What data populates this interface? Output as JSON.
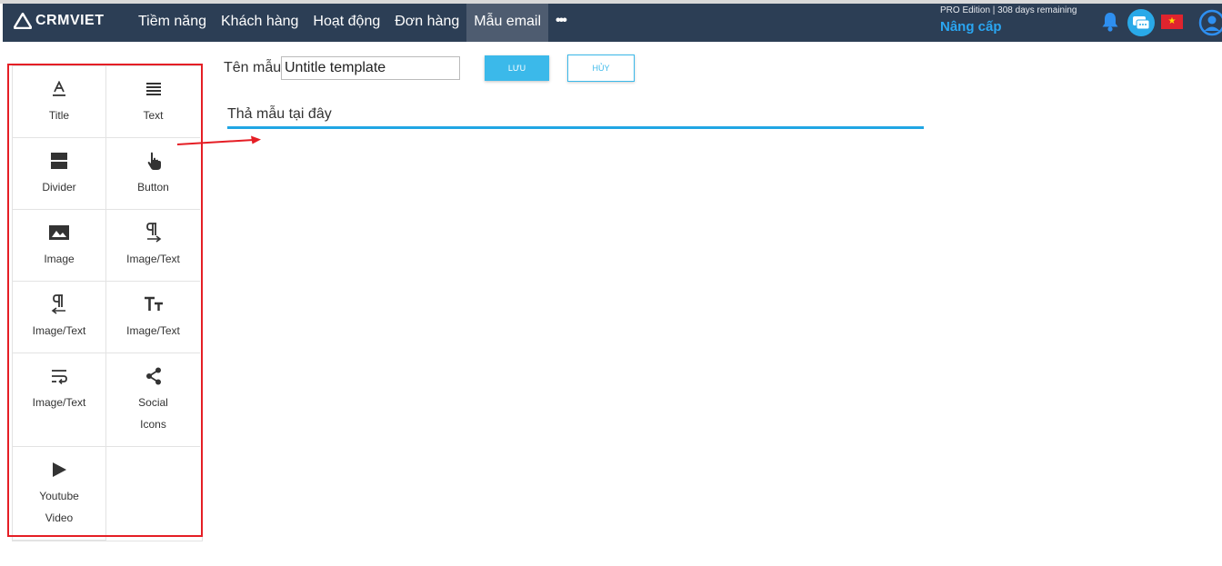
{
  "app": {
    "logo_text": "CRMVIET"
  },
  "nav": {
    "items": [
      {
        "label": "Tiềm năng"
      },
      {
        "label": "Khách hàng"
      },
      {
        "label": "Hoạt động"
      },
      {
        "label": "Đơn hàng"
      },
      {
        "label": "Mẫu email",
        "active": true
      }
    ],
    "more_label": "•••"
  },
  "account": {
    "edition": "PRO Edition | 308 days remaining",
    "upgrade_label": "Nâng cấp",
    "flag_star": "★"
  },
  "toolbox": {
    "items": [
      {
        "label": "Title",
        "icon": "title-icon"
      },
      {
        "label": "Text",
        "icon": "text-lines-icon"
      },
      {
        "label": "Divider",
        "icon": "divider-icon"
      },
      {
        "label": "Button",
        "icon": "hand-pointer-icon"
      },
      {
        "label": "Image",
        "icon": "image-icon"
      },
      {
        "label": "Image/Text",
        "icon": "paragraph-right-icon"
      },
      {
        "label": "Image/Text",
        "icon": "paragraph-left-icon"
      },
      {
        "label": "Image/Text",
        "icon": "text-size-icon"
      },
      {
        "label": "Image/Text",
        "icon": "text-wrap-icon"
      },
      {
        "label": "Social Icons",
        "icon": "share-icon"
      },
      {
        "label": "Youtube Video",
        "icon": "play-icon"
      }
    ]
  },
  "editor": {
    "name_label": "Tên mẫu",
    "name_value": "Untitle template",
    "save_label": "LƯU",
    "cancel_label": "HỦY",
    "drop_text": "Thả mẫu tại đây"
  },
  "colors": {
    "navbar": "#2c3e55",
    "accent": "#3bb9ea",
    "highlight_border": "#e51e25"
  }
}
